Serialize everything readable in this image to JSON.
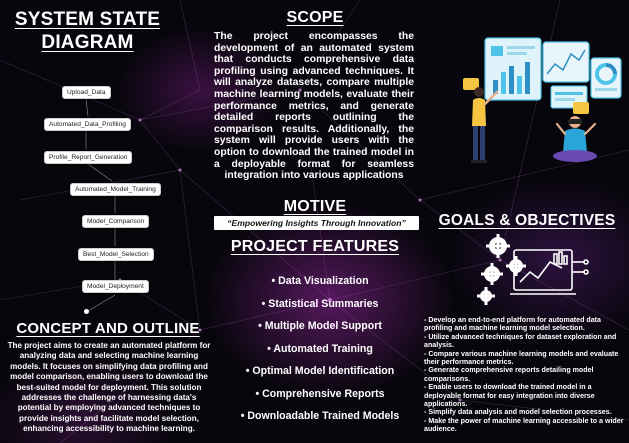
{
  "system_state_diagram": {
    "title": "SYSTEM STATE DIAGRAM",
    "states": [
      "Upload_Data",
      "Automated_Data_Profiling",
      "Profile_Report_Generation",
      "Automated_Model_Training",
      "Model_Comparison",
      "Best_Model_Selection",
      "Model_Deployment"
    ]
  },
  "scope": {
    "title": "SCOPE",
    "text": "The project encompasses the development of an automated system that conducts comprehensive data profiling using advanced techniques. It will analyze datasets, compare multiple machine learning models, evaluate their performance metrics, and generate detailed reports outlining the comparison results. Additionally, the system will provide users with the option to download the trained model in a deployable format for seamless integration into various applications"
  },
  "motive": {
    "title": "MOTIVE",
    "tagline": "“Empowering Insights Through Innovation”"
  },
  "features": {
    "title": "PROJECT FEATURES",
    "items": [
      "• Data Visualization",
      "• Statistical Summaries",
      "• Multiple Model Support",
      "• Automated Training",
      "• Optimal Model Identification",
      "• Comprehensive Reports",
      "• Downloadable Trained Models"
    ]
  },
  "concept": {
    "title": "CONCEPT AND OUTLINE",
    "text": "The project aims to create an automated platform for analyzing data and selecting machine learning models. It focuses on simplifying data profiling and model comparison, enabling users to download the best-suited model for deployment. This solution addresses the challenge of harnessing data's potential by employing advanced techniques to provide insights and facilitate model selection, enhancing accessibility to machine learning."
  },
  "goals": {
    "title": "GOALS & OBJECTIVES",
    "items": [
      "- Develop an end-to-end platform for automated data profiling and machine learning model selection.",
      "- Utilize advanced techniques for dataset exploration and analysis.",
      "- Compare various machine learning models and evaluate their performance metrics.",
      "- Generate comprehensive reports detailing model comparisons.",
      "- Enable users to download the trained model in a deployable format for easy integration into diverse applications.",
      "- Simplify data analysis and model selection processes.",
      "- Make the power of machine learning accessible to a wider audience."
    ]
  },
  "colors": {
    "background": "#07060c",
    "glow": "#962ba0",
    "text": "#ffffff",
    "accent_cyan": "#4fc3e8",
    "accent_yellow": "#f5c542"
  },
  "icons": [
    "data-dashboard-illustration",
    "gears-analytics-icon"
  ]
}
